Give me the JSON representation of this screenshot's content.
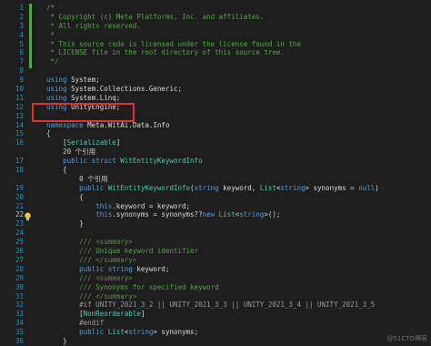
{
  "editor": {
    "lines": [
      {
        "n": "1",
        "segs": [
          [
            "c-comment",
            "/*"
          ]
        ]
      },
      {
        "n": "2",
        "segs": [
          [
            "c-comment",
            " * Copyright (c) Meta Platforms, Inc. and affiliates."
          ]
        ]
      },
      {
        "n": "3",
        "segs": [
          [
            "c-comment",
            " * All rights reserved."
          ]
        ]
      },
      {
        "n": "4",
        "segs": [
          [
            "c-comment",
            " *"
          ]
        ]
      },
      {
        "n": "5",
        "segs": [
          [
            "c-comment",
            " * This source code is licensed under the license found in the"
          ]
        ]
      },
      {
        "n": "6",
        "segs": [
          [
            "c-comment",
            " * LICENSE file in the root directory of this source tree."
          ]
        ]
      },
      {
        "n": "7",
        "segs": [
          [
            "c-comment",
            " */"
          ]
        ]
      },
      {
        "n": "8",
        "segs": []
      },
      {
        "n": "9",
        "segs": [
          [
            "c-kw",
            "using"
          ],
          [
            "c-text",
            " System;"
          ]
        ]
      },
      {
        "n": "10",
        "segs": [
          [
            "c-kw",
            "using"
          ],
          [
            "c-text",
            " System.Collections.Generic;"
          ]
        ]
      },
      {
        "n": "11",
        "segs": [
          [
            "c-kw",
            "using"
          ],
          [
            "c-text",
            " System.Linq;"
          ]
        ]
      },
      {
        "n": "12",
        "segs": [
          [
            "c-kw",
            "using"
          ],
          [
            "c-text",
            " UnityEngine;"
          ]
        ]
      },
      {
        "n": "13",
        "segs": []
      },
      {
        "n": "14",
        "segs": [
          [
            "c-kw",
            "namespace"
          ],
          [
            "c-text",
            " Meta.WitAi.Data.Info"
          ]
        ]
      },
      {
        "n": "15",
        "segs": [
          [
            "c-text",
            "{"
          ]
        ]
      },
      {
        "n": "16",
        "segs": [
          [
            "c-text",
            "    ["
          ],
          [
            "c-attr",
            "Serializable"
          ],
          [
            "c-text",
            "]"
          ]
        ]
      },
      {
        "n": "",
        "segs": [
          [
            "c-ref",
            "    20 个引用"
          ]
        ]
      },
      {
        "n": "17",
        "segs": [
          [
            "c-text",
            "    "
          ],
          [
            "c-kw",
            "public struct"
          ],
          [
            "c-text",
            " "
          ],
          [
            "c-type",
            "WitEntityKeywordInfo"
          ]
        ]
      },
      {
        "n": "18",
        "segs": [
          [
            "c-text",
            "    {"
          ]
        ]
      },
      {
        "n": "",
        "segs": [
          [
            "c-ref",
            "        0 个引用"
          ]
        ]
      },
      {
        "n": "19",
        "segs": [
          [
            "c-text",
            "        "
          ],
          [
            "c-kw",
            "public"
          ],
          [
            "c-text",
            " "
          ],
          [
            "c-type",
            "WitEntityKeywordInfo"
          ],
          [
            "c-text",
            "("
          ],
          [
            "c-kw",
            "string"
          ],
          [
            "c-text",
            " keyword, "
          ],
          [
            "c-type",
            "List"
          ],
          [
            "c-text",
            "<"
          ],
          [
            "c-kw",
            "string"
          ],
          [
            "c-text",
            "> synonyms = "
          ],
          [
            "c-kw",
            "null"
          ],
          [
            "c-text",
            ")"
          ]
        ]
      },
      {
        "n": "20",
        "segs": [
          [
            "c-text",
            "        {"
          ]
        ]
      },
      {
        "n": "21",
        "segs": [
          [
            "c-text",
            "            "
          ],
          [
            "c-kw",
            "this"
          ],
          [
            "c-text",
            ".keyword = keyword;"
          ]
        ]
      },
      {
        "n": "22",
        "segs": [
          [
            "c-text",
            "            "
          ],
          [
            "c-kw",
            "this"
          ],
          [
            "c-text",
            ".synonyms = synonyms??"
          ],
          [
            "c-kw",
            "new"
          ],
          [
            "c-text",
            " "
          ],
          [
            "c-type",
            "List"
          ],
          [
            "c-text",
            "<"
          ],
          [
            "c-kw",
            "string"
          ],
          [
            "c-text",
            ">();"
          ]
        ]
      },
      {
        "n": "23",
        "segs": [
          [
            "c-text",
            "        }"
          ]
        ]
      },
      {
        "n": "24",
        "segs": []
      },
      {
        "n": "25",
        "segs": [
          [
            "c-xmlgray",
            "        /// "
          ],
          [
            "c-xmlgray",
            "<summary>"
          ]
        ]
      },
      {
        "n": "26",
        "segs": [
          [
            "c-xmlgray",
            "        /// "
          ],
          [
            "c-xml",
            "Unique keyword identifier"
          ]
        ]
      },
      {
        "n": "27",
        "segs": [
          [
            "c-xmlgray",
            "        /// "
          ],
          [
            "c-xmlgray",
            "</summary>"
          ]
        ]
      },
      {
        "n": "28",
        "segs": [
          [
            "c-text",
            "        "
          ],
          [
            "c-kw",
            "public string"
          ],
          [
            "c-text",
            " keyword;"
          ]
        ]
      },
      {
        "n": "29",
        "segs": [
          [
            "c-xmlgray",
            "        /// "
          ],
          [
            "c-xmlgray",
            "<summary>"
          ]
        ]
      },
      {
        "n": "30",
        "segs": [
          [
            "c-xmlgray",
            "        /// "
          ],
          [
            "c-xml",
            "Synonyms for specified keyword"
          ]
        ]
      },
      {
        "n": "31",
        "segs": [
          [
            "c-xmlgray",
            "        /// "
          ],
          [
            "c-xmlgray",
            "</summary>"
          ]
        ]
      },
      {
        "n": "32",
        "segs": [
          [
            "c-pre",
            "        #if UNITY_2021_3_2 || UNITY_2021_3_3 || UNITY_2021_3_4 || UNITY_2021_3_5"
          ]
        ]
      },
      {
        "n": "33",
        "segs": [
          [
            "c-text",
            "        ["
          ],
          [
            "c-attr",
            "NonReorderable"
          ],
          [
            "c-text",
            "]"
          ]
        ]
      },
      {
        "n": "34",
        "segs": [
          [
            "c-pre",
            "        #endif"
          ]
        ]
      },
      {
        "n": "35",
        "segs": [
          [
            "c-text",
            "        "
          ],
          [
            "c-kw",
            "public"
          ],
          [
            "c-text",
            " "
          ],
          [
            "c-type",
            "List"
          ],
          [
            "c-text",
            "<"
          ],
          [
            "c-kw",
            "string"
          ],
          [
            "c-text",
            "> synonyms;"
          ]
        ]
      },
      {
        "n": "36",
        "segs": [
          [
            "c-text",
            "    }"
          ]
        ]
      }
    ],
    "current_line": "22",
    "highlighted_line": "12",
    "watermark": "@51CTO博客"
  },
  "colors": {
    "background": "#1e1e1e",
    "keyword": "#569cd6",
    "type": "#4ec9b0",
    "comment": "#57a64a",
    "line_number": "#2b91af",
    "highlight_box": "#e03131"
  },
  "icons": {
    "bulb": "lightbulb-icon"
  }
}
